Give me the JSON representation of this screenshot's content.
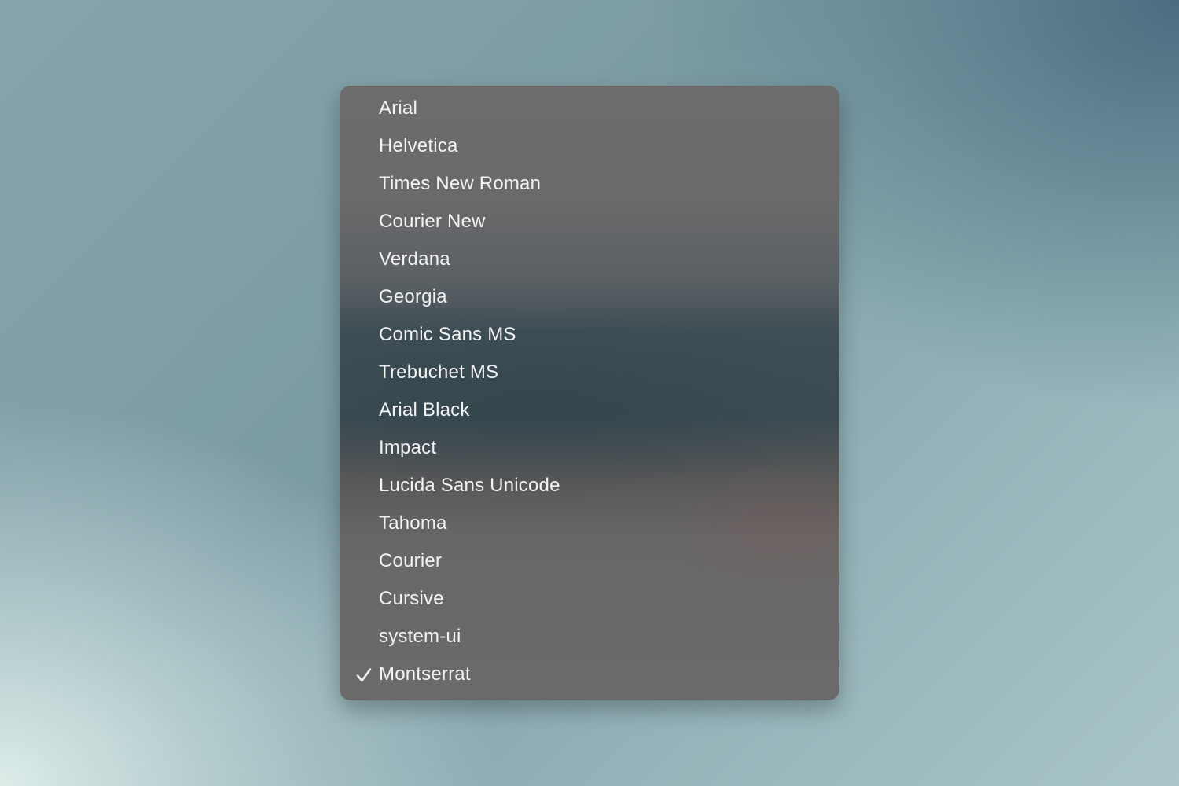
{
  "font_menu": {
    "items": [
      {
        "label": "Arial",
        "checked": false
      },
      {
        "label": "Helvetica",
        "checked": false
      },
      {
        "label": "Times New Roman",
        "checked": false
      },
      {
        "label": "Courier New",
        "checked": false
      },
      {
        "label": "Verdana",
        "checked": false
      },
      {
        "label": "Georgia",
        "checked": false
      },
      {
        "label": "Comic Sans MS",
        "checked": false
      },
      {
        "label": "Trebuchet MS",
        "checked": false
      },
      {
        "label": "Arial Black",
        "checked": false
      },
      {
        "label": "Impact",
        "checked": false
      },
      {
        "label": "Lucida Sans Unicode",
        "checked": false
      },
      {
        "label": "Tahoma",
        "checked": false
      },
      {
        "label": "Courier",
        "checked": false
      },
      {
        "label": "Cursive",
        "checked": false
      },
      {
        "label": "system-ui",
        "checked": false
      },
      {
        "label": "Montserrat",
        "checked": true
      }
    ],
    "check_icon": "checkmark-icon",
    "text_color": "#f2f2f2"
  }
}
